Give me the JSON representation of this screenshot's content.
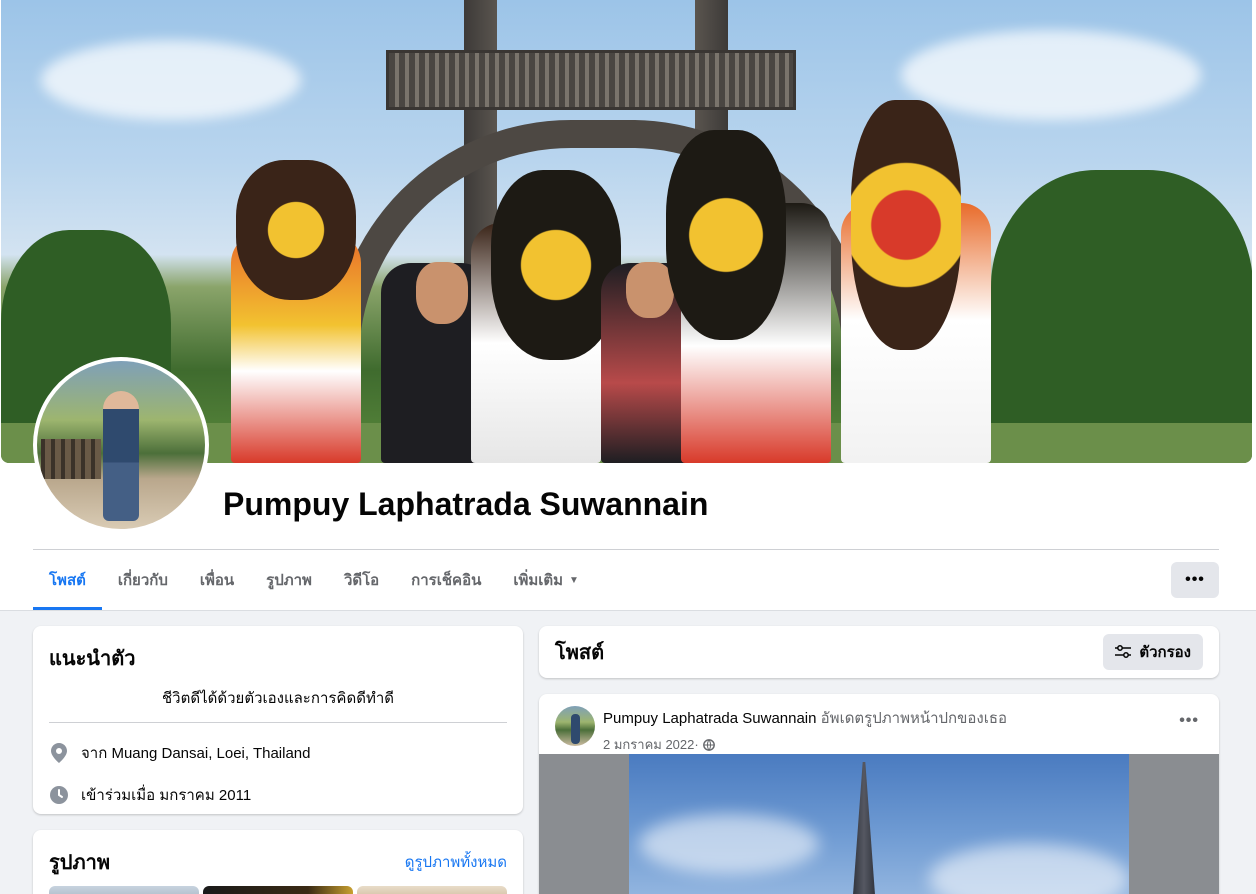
{
  "profile": {
    "name": "Pumpuy Laphatrada Suwannain"
  },
  "tabs": [
    {
      "label": "โพสต์",
      "active": true
    },
    {
      "label": "เกี่ยวกับ"
    },
    {
      "label": "เพื่อน"
    },
    {
      "label": "รูปภาพ"
    },
    {
      "label": "วิดีโอ"
    },
    {
      "label": "การเช็คอิน"
    },
    {
      "label": "เพิ่มเติม"
    }
  ],
  "more_button": {
    "label": "•••"
  },
  "intro": {
    "title": "แนะนำตัว",
    "bio": "ชีวิตดีได้ด้วยตัวเองและการคิดดีทำดี",
    "location_prefix": "จาก",
    "location": "Muang Dansai, Loei, Thailand",
    "joined": "เข้าร่วมเมื่อ มกราคม 2011"
  },
  "photos": {
    "title": "รูปภาพ",
    "see_all": "ดูรูปภาพทั้งหมด"
  },
  "posts_section": {
    "title": "โพสต์",
    "filter_label": "ตัวกรอง"
  },
  "post": {
    "author": "Pumpuy Laphatrada Suwannain",
    "action": "อัพเดตรูปภาพหน้าปกของเธอ",
    "date": "2 มกราคม 2022",
    "separator": " · ",
    "menu": "•••"
  },
  "colors": {
    "accent": "#1877f2",
    "background": "#f0f2f5",
    "secondary_text": "#65676b"
  }
}
